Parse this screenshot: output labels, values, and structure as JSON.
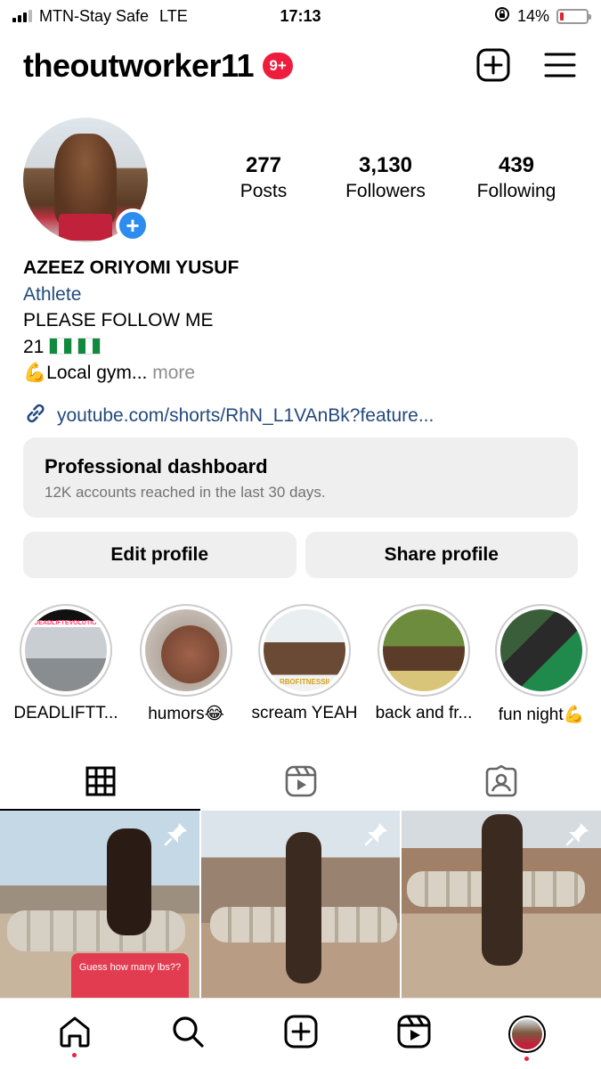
{
  "status_bar": {
    "carrier": "MTN-Stay Safe",
    "network": "LTE",
    "time": "17:13",
    "battery": "14%",
    "battery_level": 0.14
  },
  "header": {
    "username": "theoutworker11",
    "notification_count": "9+",
    "icons": [
      "new-post-icon",
      "menu-icon"
    ]
  },
  "profile": {
    "stats": [
      {
        "value": "277",
        "label": "Posts"
      },
      {
        "value": "3,130",
        "label": "Followers"
      },
      {
        "value": "439",
        "label": "Following"
      }
    ],
    "name": "AZEEZ ORIYOMI YUSUF",
    "category": "Athlete",
    "bio_line1": "PLEASE FOLLOW ME",
    "bio_line2": "21",
    "bio_line3_emoji": "💪",
    "bio_line3": "Local gym...",
    "more": "more",
    "link": "youtube.com/shorts/RhN_L1VAnBk?feature..."
  },
  "dashboard": {
    "title": "Professional dashboard",
    "subtitle": "12K accounts reached in the last 30 days."
  },
  "buttons": {
    "edit": "Edit profile",
    "share": "Share profile"
  },
  "highlights": [
    {
      "label": "DEADLIFTT...",
      "thumb_text": "#DEADLIFTEVOLUTION"
    },
    {
      "label": "humors😂",
      "thumb_text": ""
    },
    {
      "label": "scream YEAH",
      "thumb_text": "RBOFITNESSII"
    },
    {
      "label": "back and fr...",
      "thumb_text": ""
    },
    {
      "label": "fun night💪",
      "thumb_text": ""
    }
  ],
  "tabs": [
    "grid-icon",
    "reels-icon",
    "tagged-icon"
  ],
  "posts": [
    {
      "caption": "Guess how many lbs??",
      "pinned": true
    },
    {
      "caption": "",
      "pinned": true
    },
    {
      "caption": "",
      "pinned": true
    }
  ],
  "bottom_nav": [
    "home-icon",
    "search-icon",
    "create-icon",
    "reels-icon",
    "profile-avatar"
  ],
  "colors": {
    "accent_blue": "#2d8cf0",
    "link_blue": "#234a7c",
    "badge_red": "#ee1d3e",
    "secondary_gray": "#737373",
    "button_bg": "#efefef"
  }
}
